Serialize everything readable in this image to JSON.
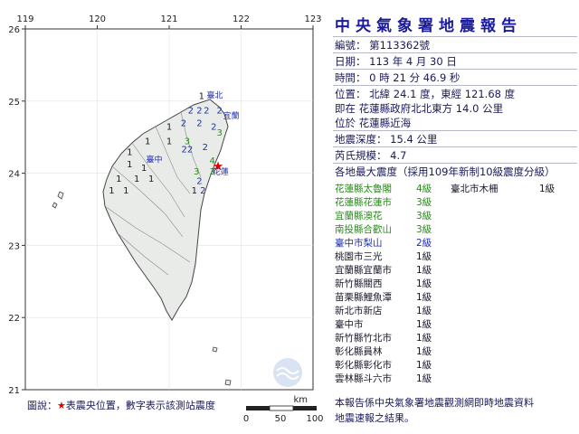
{
  "report": {
    "title": "中央氣象署地震報告",
    "number": "編號： 第113362號",
    "date": "日期： 113 年 4 月 30 日",
    "time": "時間： 0 時 21 分 46.9 秒",
    "location": "位置： 北緯 24.1 度，東經 121.68 度",
    "location_desc": "即在 花蓮縣政府北北東方 14.0 公里",
    "region": "位於 花蓮縣近海",
    "depth": "地震深度： 15.4 公里",
    "magnitude": "芮氏規模： 4.7",
    "intensity_header": "各地最大震度（採用109年新制10級震度分級）",
    "footnote_line1": "本報告係中央氣象署地震觀測網即時地震資料",
    "footnote_line2": "地震速報之結果。"
  },
  "stations": [
    {
      "name": "花蓮縣太魯閣",
      "level": "4級",
      "color": "#2b8a1e"
    },
    {
      "name": "花蓮縣花蓮市",
      "level": "3級",
      "color": "#2b8a1e"
    },
    {
      "name": "宜蘭縣澳花",
      "level": "3級",
      "color": "#2b8a1e"
    },
    {
      "name": "南投縣合歡山",
      "level": "3級",
      "color": "#2b8a1e"
    },
    {
      "name": "臺中市梨山",
      "level": "2級",
      "color": "#1f2fb0"
    },
    {
      "name": "桃園市三光",
      "level": "1級",
      "color": "#1a1a2a"
    },
    {
      "name": "宜蘭縣宜蘭市",
      "level": "1級",
      "color": "#1a1a2a"
    },
    {
      "name": "新竹縣關西",
      "level": "1級",
      "color": "#1a1a2a"
    },
    {
      "name": "苗栗縣鯉魚潭",
      "level": "1級",
      "color": "#1a1a2a"
    },
    {
      "name": "新北市新店",
      "level": "1級",
      "color": "#1a1a2a"
    },
    {
      "name": "臺中市",
      "level": "1級",
      "color": "#1a1a2a"
    },
    {
      "name": "新竹縣竹北市",
      "level": "1級",
      "color": "#1a1a2a"
    },
    {
      "name": "彰化縣員林",
      "level": "1級",
      "color": "#1a1a2a"
    },
    {
      "name": "彰化縣彰化市",
      "level": "1級",
      "color": "#1a1a2a"
    },
    {
      "name": "雲林縣斗六市",
      "level": "1級",
      "color": "#1a1a2a"
    }
  ],
  "extra_station": {
    "name": "臺北市木柵",
    "level": "1級"
  },
  "map": {
    "lon_ticks": [
      "119",
      "120",
      "121",
      "122",
      "123"
    ],
    "lat_ticks": [
      "26",
      "25",
      "24",
      "23",
      "22",
      "21"
    ],
    "lon_range": [
      119,
      123
    ],
    "lat_range": [
      21,
      26
    ],
    "epicenter": {
      "lon": 121.68,
      "lat": 24.1
    },
    "place_labels": [
      {
        "text": "臺北",
        "lon": 121.52,
        "lat": 25.04
      },
      {
        "text": "宜蘭",
        "lon": 121.75,
        "lat": 24.76
      },
      {
        "text": "臺中",
        "lon": 120.68,
        "lat": 24.15
      },
      {
        "text": "花蓮",
        "lon": 121.6,
        "lat": 23.98
      }
    ],
    "intensity_marks": [
      {
        "v": "1",
        "lon": 121.45,
        "lat": 25.03,
        "c": "#1a1a2a"
      },
      {
        "v": "2",
        "lon": 121.3,
        "lat": 24.83,
        "c": "#1f2fb0"
      },
      {
        "v": "2",
        "lon": 121.42,
        "lat": 24.83,
        "c": "#1f2fb0"
      },
      {
        "v": "2",
        "lon": 121.52,
        "lat": 24.83,
        "c": "#1f2fb0"
      },
      {
        "v": "2",
        "lon": 121.7,
        "lat": 24.83,
        "c": "#1f2fb0"
      },
      {
        "v": "2",
        "lon": 121.62,
        "lat": 24.6,
        "c": "#1f2fb0"
      },
      {
        "v": "1",
        "lon": 121.0,
        "lat": 24.6,
        "c": "#1a1a2a"
      },
      {
        "v": "2",
        "lon": 121.2,
        "lat": 24.65,
        "c": "#1f2fb0"
      },
      {
        "v": "2",
        "lon": 121.42,
        "lat": 24.65,
        "c": "#1f2fb0"
      },
      {
        "v": "3",
        "lon": 121.7,
        "lat": 24.52,
        "c": "#2b8a1e"
      },
      {
        "v": "1",
        "lon": 120.7,
        "lat": 24.4,
        "c": "#1a1a2a"
      },
      {
        "v": "1",
        "lon": 121.0,
        "lat": 24.4,
        "c": "#1a1a2a"
      },
      {
        "v": "3",
        "lon": 121.25,
        "lat": 24.4,
        "c": "#2b8a1e"
      },
      {
        "v": "2",
        "lon": 121.5,
        "lat": 24.32,
        "c": "#1f2fb0"
      },
      {
        "v": "1",
        "lon": 120.45,
        "lat": 24.25,
        "c": "#1a1a2a"
      },
      {
        "v": "22",
        "lon": 121.25,
        "lat": 24.29,
        "c": "#1f2fb0"
      },
      {
        "v": "4",
        "lon": 121.6,
        "lat": 24.13,
        "c": "#2b8a1e"
      },
      {
        "v": "1",
        "lon": 120.45,
        "lat": 24.08,
        "c": "#1a1a2a"
      },
      {
        "v": "1",
        "lon": 120.65,
        "lat": 24.03,
        "c": "#1a1a2a"
      },
      {
        "v": "3",
        "lon": 121.38,
        "lat": 23.98,
        "c": "#2b8a1e"
      },
      {
        "v": "1",
        "lon": 120.3,
        "lat": 23.88,
        "c": "#1a1a2a"
      },
      {
        "v": "1",
        "lon": 120.55,
        "lat": 23.88,
        "c": "#1a1a2a"
      },
      {
        "v": "1",
        "lon": 120.75,
        "lat": 23.88,
        "c": "#1a1a2a"
      },
      {
        "v": "2",
        "lon": 121.42,
        "lat": 23.85,
        "c": "#1f2fb0"
      },
      {
        "v": "3",
        "lon": 121.6,
        "lat": 23.98,
        "c": "#2b8a1e"
      },
      {
        "v": "1",
        "lon": 120.2,
        "lat": 23.72,
        "c": "#1a1a2a"
      },
      {
        "v": "1",
        "lon": 120.4,
        "lat": 23.72,
        "c": "#1a1a2a"
      },
      {
        "v": "1",
        "lon": 121.35,
        "lat": 23.72,
        "c": "#1a1a2a"
      },
      {
        "v": "2",
        "lon": 121.47,
        "lat": 23.72,
        "c": "#1f2fb0"
      }
    ],
    "scale_bar": {
      "unit": "km",
      "ticks": [
        "0",
        "50",
        "100"
      ]
    },
    "legend": {
      "prefix": "圖說：",
      "star": "★",
      "text": "表震央位置，數字表示該測站震度"
    }
  }
}
